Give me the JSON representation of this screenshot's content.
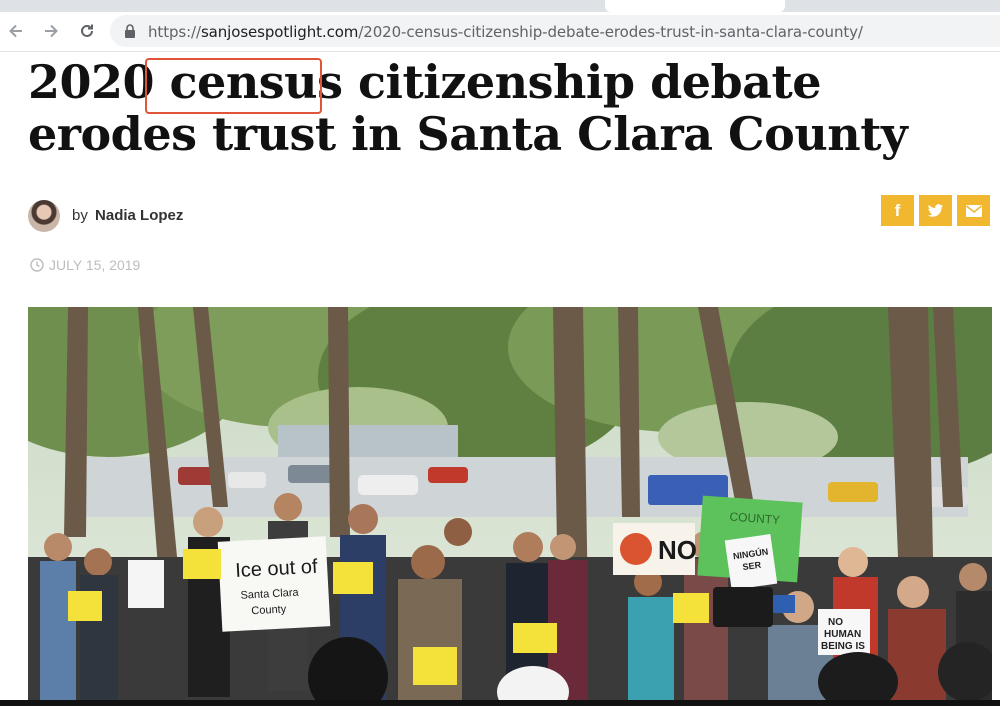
{
  "browser": {
    "url_scheme": "https://",
    "url_host": "sanjosespotlight.com",
    "url_path": "/2020-census-citizenship-debate-erodes-trust-in-santa-clara-county/"
  },
  "article": {
    "headline_part1": "2020 ",
    "headline_highlight": "census",
    "headline_part2": " citizenship debate erodes trust in Santa Clara County",
    "byline_prefix": "by",
    "author": "Nadia Lopez",
    "date": "JULY 15, 2019"
  },
  "share": {
    "facebook": "f",
    "twitter": "twitter-icon",
    "email": "email-icon"
  },
  "photo": {
    "signs": {
      "ice_line1": "Ice out of",
      "ice_line2": "Santa Clara",
      "ice_line3": "County",
      "no": "NO",
      "ningun_line1": "NINGÚN",
      "ningun_line2": "SER",
      "no_human_line1": "NO",
      "no_human_line2": "HUMAN",
      "no_human_line3": "BEING IS",
      "county_sign": "COUNTY"
    }
  },
  "colors": {
    "share_yellow": "#f1b72f",
    "highlight": "#e0553a",
    "headline": "#111111"
  }
}
